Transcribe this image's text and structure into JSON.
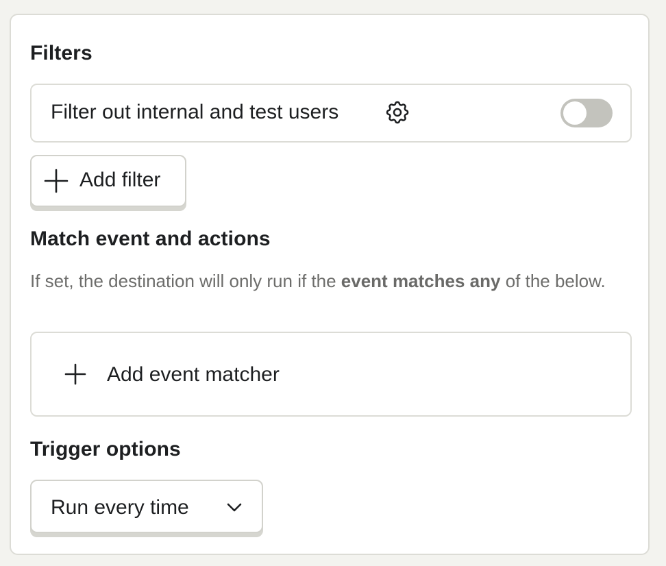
{
  "filters": {
    "title": "Filters",
    "internal_filter": {
      "label": "Filter out internal and test users",
      "settings_icon": "gear-icon",
      "enabled": false
    },
    "add_filter_label": "Add filter"
  },
  "match": {
    "title": "Match event and actions",
    "description_pre": "If set, the destination will only run if the ",
    "description_bold": "event matches any",
    "description_post": " of the below.",
    "add_event_label": "Add event matcher"
  },
  "trigger": {
    "title": "Trigger options",
    "selected": "Run every time"
  },
  "colors": {
    "toggle_off": "#c3c3bd",
    "border": "#dcdcd6",
    "page_bg": "#f3f3ef"
  }
}
